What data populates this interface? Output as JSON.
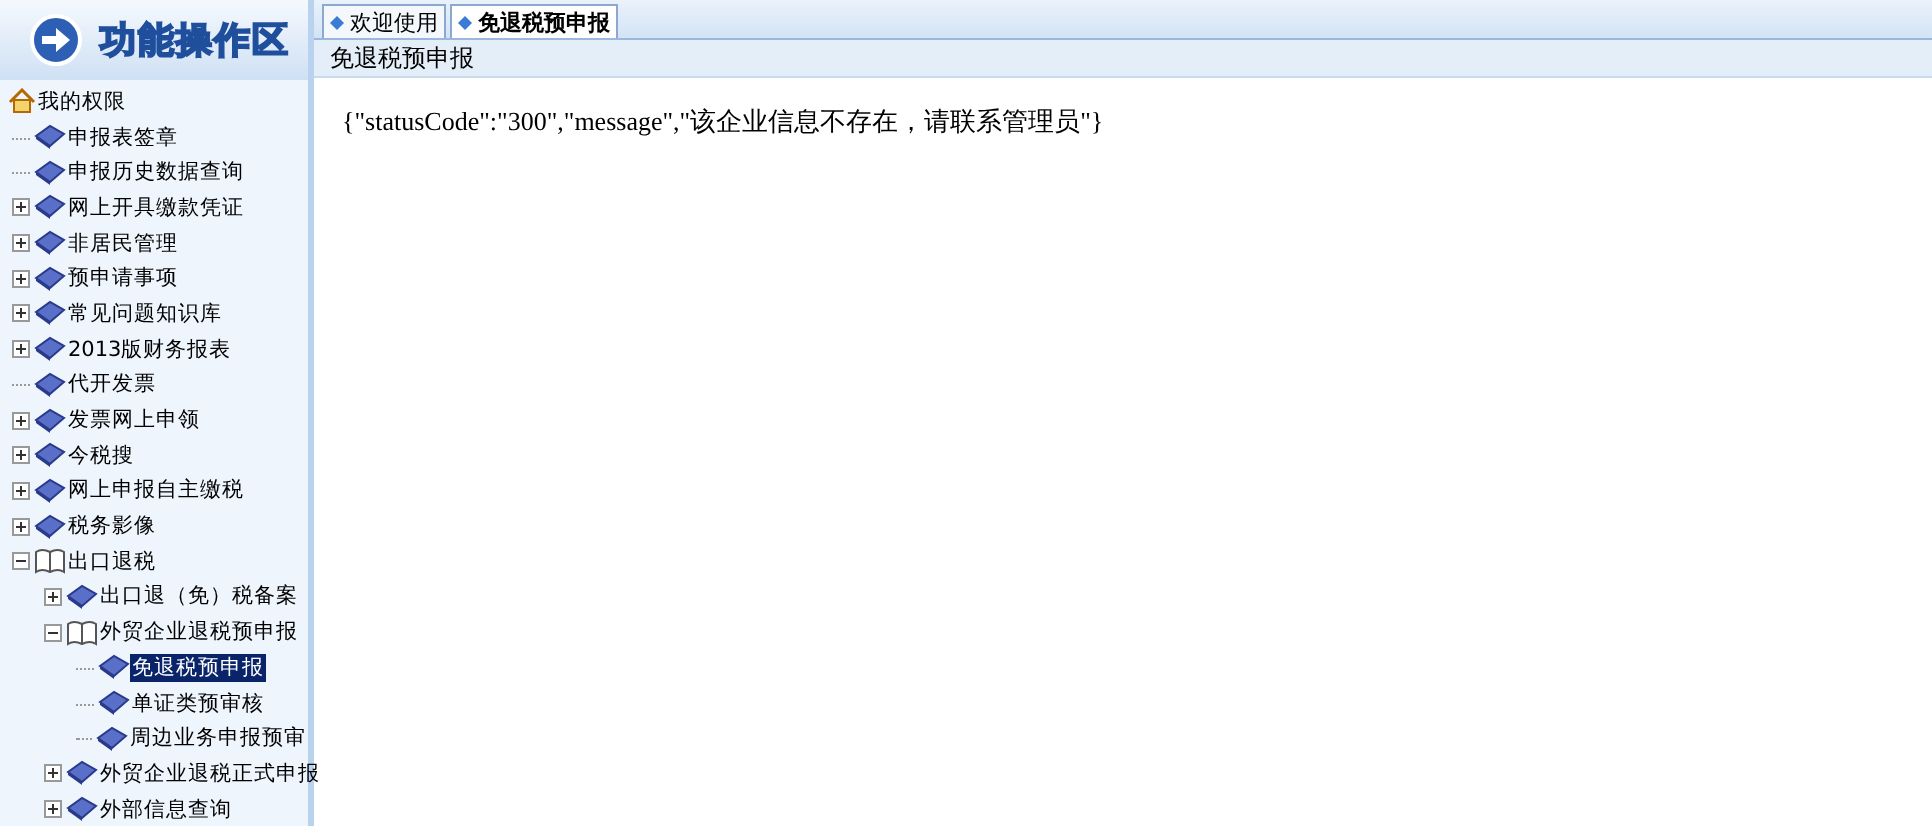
{
  "sidebar": {
    "title": "功能操作区",
    "tree": {
      "label": "我的权限",
      "children": [
        {
          "label": "申报表签章",
          "selected": false
        },
        {
          "label": "申报历史数据查询",
          "selected": false
        },
        {
          "label": "网上开具缴款凭证",
          "selected": false,
          "expanded": false
        },
        {
          "label": "非居民管理",
          "selected": false,
          "expanded": false
        },
        {
          "label": "预申请事项",
          "selected": false,
          "expanded": false
        },
        {
          "label": "常见问题知识库",
          "selected": false,
          "expanded": false
        },
        {
          "label": "2013版财务报表",
          "selected": false,
          "expanded": false
        },
        {
          "label": "代开发票",
          "selected": false
        },
        {
          "label": "发票网上申领",
          "selected": false,
          "expanded": false
        },
        {
          "label": "今税搜",
          "selected": false,
          "expanded": false
        },
        {
          "label": "网上申报自主缴税",
          "selected": false,
          "expanded": false
        },
        {
          "label": "税务影像",
          "selected": false,
          "expanded": false
        },
        {
          "label": "出口退税",
          "selected": false,
          "expanded": true,
          "children": [
            {
              "label": "出口退（免）税备案",
              "selected": false,
              "expanded": false
            },
            {
              "label": "外贸企业退税预申报",
              "selected": false,
              "expanded": true,
              "children": [
                {
                  "label": "免退税预申报",
                  "selected": true
                },
                {
                  "label": "单证类预审核",
                  "selected": false
                },
                {
                  "label": "周边业务申报预审",
                  "selected": false
                }
              ]
            },
            {
              "label": "外贸企业退税正式申报",
              "selected": false,
              "expanded": false
            },
            {
              "label": "外部信息查询",
              "selected": false,
              "expanded": false
            }
          ]
        }
      ]
    }
  },
  "tabs": [
    {
      "label": "欢迎使用",
      "selected": false
    },
    {
      "label": "免退税预申报",
      "selected": true
    }
  ],
  "panel": {
    "title": "免退税预申报",
    "content": "{\"statusCode\":\"300\",\"message\",\"该企业信息不存在，请联系管理员\"}"
  }
}
